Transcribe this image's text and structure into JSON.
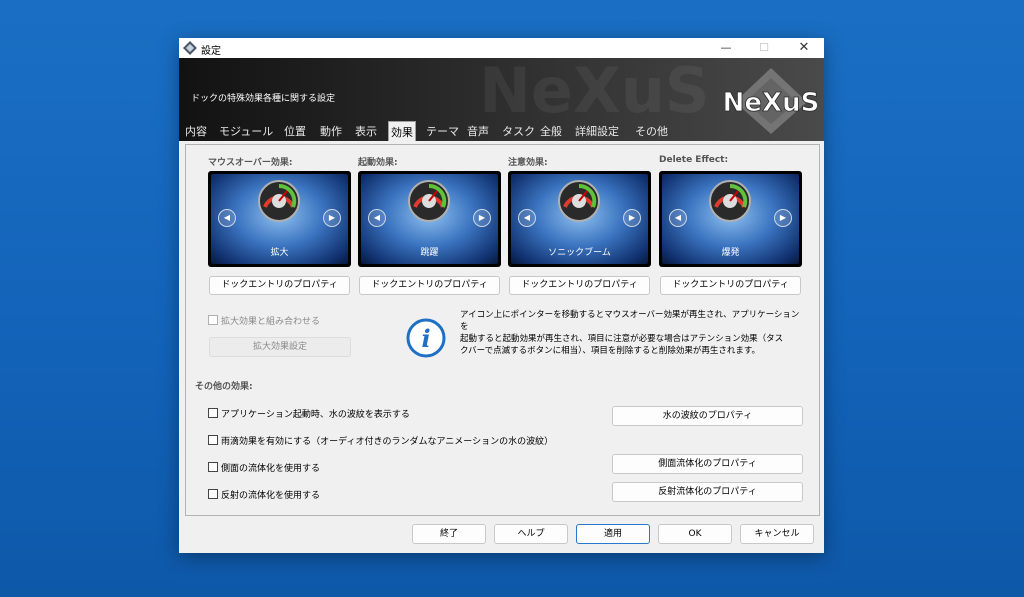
{
  "window": {
    "title": "設定",
    "minimize": "—",
    "maximize": "☐",
    "close": "✕"
  },
  "banner": {
    "subtitle": "ドックの特殊効果各種に関する設定",
    "logo": "NeXuS"
  },
  "tabs": [
    {
      "label": "内容"
    },
    {
      "label": "モジュール"
    },
    {
      "label": "位置"
    },
    {
      "label": "動作"
    },
    {
      "label": "表示"
    },
    {
      "label": "効果",
      "active": true
    },
    {
      "label": "テーマ"
    },
    {
      "label": "音声"
    },
    {
      "label": "タスク"
    },
    {
      "label": "全般"
    },
    {
      "label": "詳細設定"
    },
    {
      "label": "その他"
    }
  ],
  "effects": [
    {
      "title": "マウスオーバー効果:",
      "caption": "拡大",
      "button": "ドックエントリのプロパティ"
    },
    {
      "title": "起動効果:",
      "caption": "跳躍",
      "button": "ドックエントリのプロパティ"
    },
    {
      "title": "注意効果:",
      "caption": "ソニックブーム",
      "button": "ドックエントリのプロパティ"
    },
    {
      "title": "Delete Effect:",
      "caption": "爆発",
      "button": "ドックエントリのプロパティ"
    }
  ],
  "zoom": {
    "combine_label": "拡大効果と組み合わせる",
    "settings_button": "拡大効果設定"
  },
  "info": {
    "line1": "アイコン上にポインターを移動するとマウスオーバー効果が再生され、アプリケーションを",
    "line2": "起動すると起動効果が再生され、項目に注意が必要な場合はアテンション効果（タス",
    "line3": "クバーで点滅するボタンに相当）、項目を削除すると削除効果が再生されます。"
  },
  "other": {
    "title": "その他の効果:",
    "options": [
      {
        "label": "アプリケーション起動時、水の波紋を表示する",
        "checked": false
      },
      {
        "label": "雨滴効果を有効にする（オーディオ付きのランダムなアニメーションの水の波紋）",
        "checked": false
      },
      {
        "label": "側面の流体化を使用する",
        "checked": false
      },
      {
        "label": "反射の流体化を使用する",
        "checked": false
      }
    ],
    "ripple_button": "水の波紋のプロパティ",
    "side_button": "側面流体化のプロパティ",
    "reflection_button": "反射流体化のプロパティ"
  },
  "footer": {
    "exit": "終了",
    "help": "ヘルプ",
    "apply": "適用",
    "ok": "OK",
    "cancel": "キャンセル"
  },
  "colors": {
    "desktop": "#1262b8",
    "banner": "#2b2b2b",
    "accent": "#2878d0",
    "info_icon": "#1f6fc4"
  }
}
